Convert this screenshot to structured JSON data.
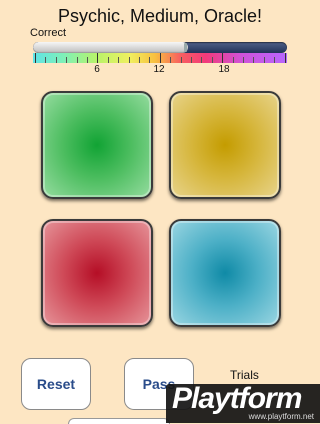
{
  "header": {
    "title": "Psychic, Medium, Oracle!",
    "correct_label": "Correct"
  },
  "progress": {
    "fraction": 0.61,
    "scale_labels": [
      "6",
      "12",
      "18"
    ]
  },
  "cards": [
    {
      "color_name": "green",
      "color": "#11a334"
    },
    {
      "color_name": "yellow",
      "color": "#c49c00"
    },
    {
      "color_name": "red",
      "color": "#b50e26"
    },
    {
      "color_name": "blue",
      "color": "#0f8aa6"
    }
  ],
  "controls": {
    "reset_label": "Reset",
    "pass_label": "Pass",
    "trials_label": "Trials"
  },
  "watermark": {
    "brand": "Playtform",
    "url": "www.playtform.net"
  }
}
